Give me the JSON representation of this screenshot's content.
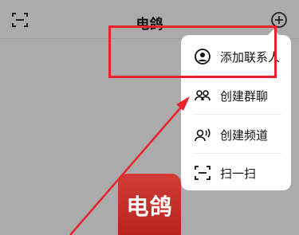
{
  "header": {
    "title": "电鸽",
    "scan_icon": "scan-icon",
    "add_icon": "plus-circle-icon"
  },
  "menu": {
    "items": [
      {
        "label": "添加联系人",
        "icon": "person-circle-icon"
      },
      {
        "label": "创建群聊",
        "icon": "group-icon"
      },
      {
        "label": "创建频道",
        "icon": "broadcast-person-icon"
      },
      {
        "label": "扫一扫",
        "icon": "scan-icon"
      }
    ]
  },
  "logo": {
    "text": "电鸽"
  },
  "annotation": {
    "color": "#e8232b"
  },
  "colors": {
    "background": "#ababab",
    "logo": "#c82e2a"
  }
}
